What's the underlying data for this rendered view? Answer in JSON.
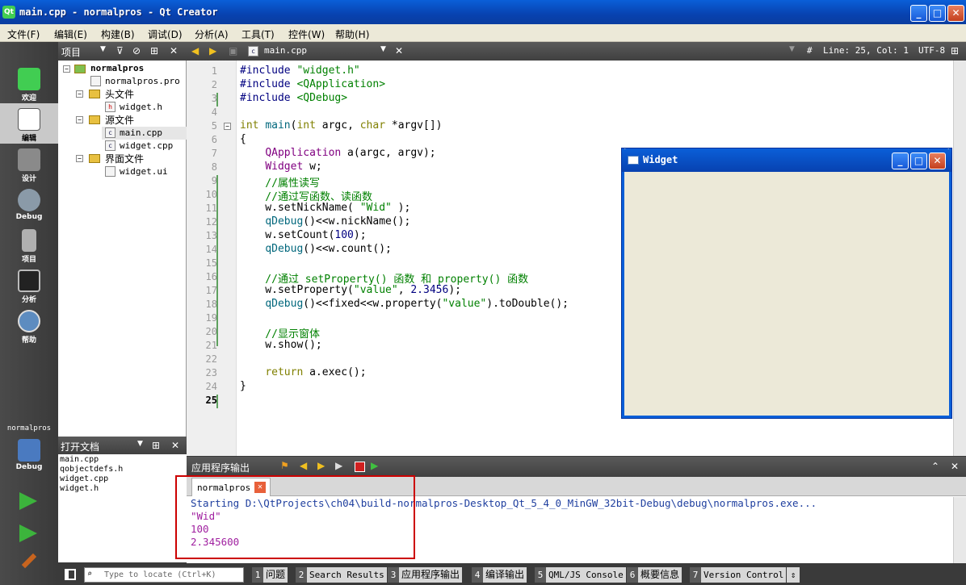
{
  "window": {
    "title": "main.cpp - normalpros - Qt Creator",
    "buttons": [
      "_",
      "□",
      "✕"
    ]
  },
  "menu": [
    "文件(F)",
    "编辑(E)",
    "构建(B)",
    "调试(D)",
    "分析(A)",
    "工具(T)",
    "控件(W)",
    "帮助(H)"
  ],
  "modes": [
    {
      "label": "欢迎",
      "icon": "welcome-icon"
    },
    {
      "label": "编辑",
      "icon": "edit-icon"
    },
    {
      "label": "设计",
      "icon": "design-icon"
    },
    {
      "label": "Debug",
      "icon": "debug-icon"
    },
    {
      "label": "项目",
      "icon": "projects-icon"
    },
    {
      "label": "分析",
      "icon": "analyze-icon"
    },
    {
      "label": "帮助",
      "icon": "help-icon"
    }
  ],
  "kit": {
    "project": "normalpros",
    "mode": "Debug"
  },
  "project_panel": {
    "title": "项目",
    "tree": [
      {
        "label": "normalpros",
        "level": 0
      },
      {
        "label": "normalpros.pro",
        "level": 1
      },
      {
        "label": "头文件",
        "level": 1
      },
      {
        "label": "widget.h",
        "level": 2
      },
      {
        "label": "源文件",
        "level": 1
      },
      {
        "label": "main.cpp",
        "level": 2
      },
      {
        "label": "widget.cpp",
        "level": 2
      },
      {
        "label": "界面文件",
        "level": 1
      },
      {
        "label": "widget.ui",
        "level": 2
      }
    ]
  },
  "open_docs": {
    "title": "打开文档",
    "files": [
      "main.cpp",
      "qobjectdefs.h",
      "widget.cpp",
      "widget.h"
    ]
  },
  "editor": {
    "file": "main.cpp",
    "cursor": "Line: 25, Col: 1",
    "encoding": "UTF-8",
    "hash": "#",
    "lines": [
      "1",
      "2",
      "3",
      "4",
      "5",
      "6",
      "7",
      "8",
      "9",
      "10",
      "11",
      "12",
      "13",
      "14",
      "15",
      "16",
      "17",
      "18",
      "19",
      "20",
      "21",
      "22",
      "23",
      "24",
      "25"
    ]
  },
  "widget_window": {
    "title": "Widget"
  },
  "output": {
    "title": "应用程序输出",
    "tab": "normalpros",
    "lines": [
      "Starting D:\\QtProjects\\ch04\\build-normalpros-Desktop_Qt_5_4_0_MinGW_32bit-Debug\\debug\\normalpros.exe...",
      "\"Wid\"",
      "100",
      "2.345600"
    ]
  },
  "statusbar": {
    "locate_placeholder": "Type to locate (Ctrl+K)",
    "panes": [
      {
        "n": "1",
        "label": "问题"
      },
      {
        "n": "2",
        "label": "Search Results"
      },
      {
        "n": "3",
        "label": "应用程序输出"
      },
      {
        "n": "4",
        "label": "编译输出"
      },
      {
        "n": "5",
        "label": "QML/JS Console"
      },
      {
        "n": "6",
        "label": "概要信息"
      },
      {
        "n": "7",
        "label": "Version Control"
      }
    ]
  }
}
